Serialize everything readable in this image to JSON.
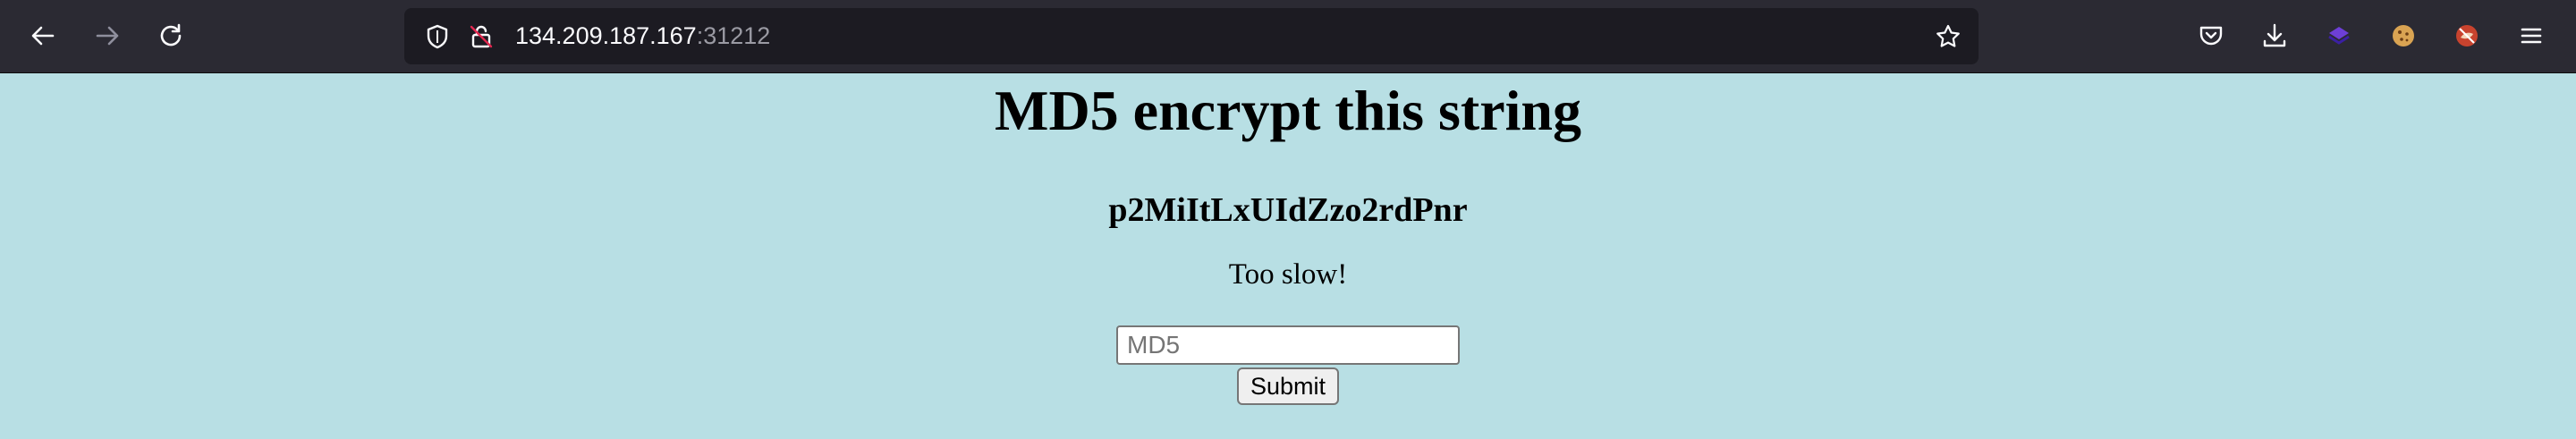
{
  "browser": {
    "url_host": "134.209.187.167",
    "url_port": ":31212",
    "icons": [
      "back-icon",
      "forward-icon",
      "reload-icon",
      "shield-icon",
      "lock-warning-icon",
      "bookmark-star-icon",
      "pocket-icon",
      "download-icon",
      "extension-icon",
      "cookie-icon",
      "extension-icon",
      "menu-icon"
    ],
    "colors": {
      "toolbar": "#2b2a33",
      "urlbar": "#1c1b22"
    }
  },
  "page": {
    "title": "MD5 encrypt this string",
    "challenge_string": "p2MiItLxUIdZzo2rdPnr",
    "status": "Too slow!",
    "input_placeholder": "MD5",
    "input_value": "",
    "submit_label": "Submit",
    "background": "#b8dfe4"
  }
}
